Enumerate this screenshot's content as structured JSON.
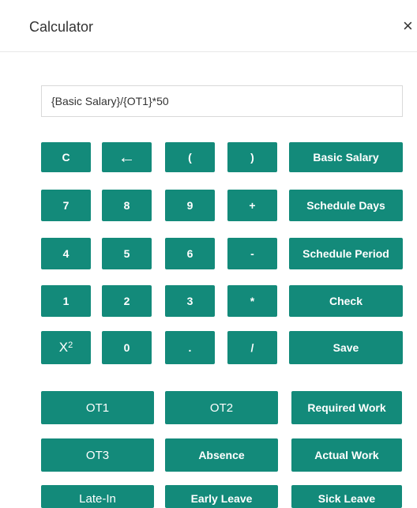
{
  "header": {
    "title": "Calculator",
    "close_glyph": "×"
  },
  "formula": {
    "value": "{Basic Salary}/{OT1}*50"
  },
  "keypad": {
    "clear": "C",
    "backspace": "←",
    "paren_open": "(",
    "paren_close": ")",
    "seven": "7",
    "eight": "8",
    "nine": "9",
    "plus": "+",
    "four": "4",
    "five": "5",
    "six": "6",
    "minus": "-",
    "one": "1",
    "two": "2",
    "three": "3",
    "multiply": "*",
    "square_base": "X",
    "square_exp": "2",
    "zero": "0",
    "dot": ".",
    "divide": "/"
  },
  "actions": {
    "basic_salary": "Basic Salary",
    "schedule_days": "Schedule Days",
    "schedule_period": "Schedule Period",
    "check": "Check",
    "save": "Save"
  },
  "fields": {
    "ot1": "OT1",
    "ot2": "OT2",
    "required_work": "Required Work",
    "ot3": "OT3",
    "absence": "Absence",
    "actual_work": "Actual Work",
    "late_in": "Late-In",
    "early_leave": "Early Leave",
    "sick_leave": "Sick Leave"
  },
  "colors": {
    "button": "#138a7a",
    "button_text": "#ffffff"
  },
  "icons": {
    "close": "close-icon",
    "backspace": "backspace-arrow-icon"
  }
}
